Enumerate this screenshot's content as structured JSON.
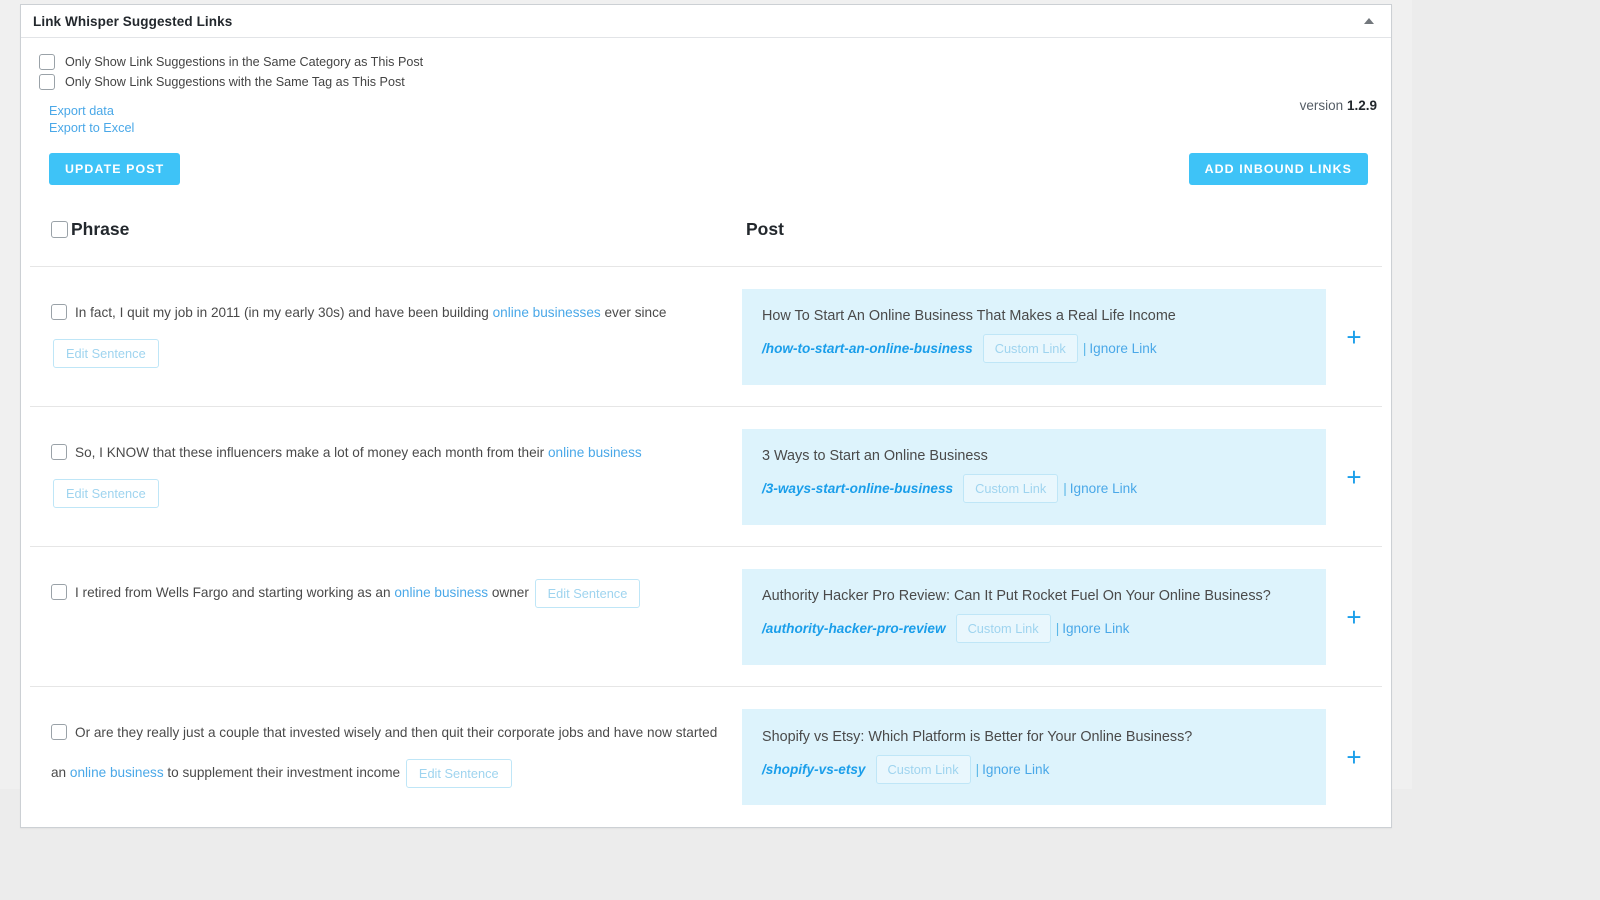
{
  "panel": {
    "title": "Link Whisper Suggested Links",
    "toggle_icon": "chevron-up-icon",
    "version_label": "version",
    "version_number": "1.2.9"
  },
  "filters": [
    {
      "label": "Only Show Link Suggestions in the Same Category as This Post",
      "checked": false
    },
    {
      "label": "Only Show Link Suggestions with the Same Tag as This Post",
      "checked": false
    }
  ],
  "export": {
    "data_label": "Export data",
    "excel_label": "Export to Excel"
  },
  "buttons": {
    "update_post": "UPDATE POST",
    "add_inbound_links": "ADD INBOUND LINKS"
  },
  "table": {
    "headers": {
      "phrase": "Phrase",
      "post": "Post"
    },
    "row_actions": {
      "edit_sentence": "Edit Sentence",
      "custom_link": "Custom Link",
      "ignore_link": "Ignore Link",
      "separator": "|",
      "add_icon": "plus-icon"
    },
    "rows": [
      {
        "phrase_pre": "In fact, I quit my job in 2011 (in my early 30s) and have been building ",
        "phrase_kw": "online businesses",
        "phrase_post": " ever since ",
        "post_title": "How To Start An Online Business That Makes a Real Life Income",
        "post_slug": "/how-to-start-an-online-business"
      },
      {
        "phrase_pre": "So, I KNOW that these influencers make a lot of money each month from their ",
        "phrase_kw": "online business",
        "phrase_post": " ",
        "post_title": "3 Ways to Start an Online Business",
        "post_slug": "/3-ways-start-online-business"
      },
      {
        "phrase_pre": "I retired from Wells Fargo and starting working as an ",
        "phrase_kw": "online business",
        "phrase_post": " owner ",
        "post_title": "Authority Hacker Pro Review: Can It Put Rocket Fuel On Your Online Business?",
        "post_slug": "/authority-hacker-pro-review"
      },
      {
        "phrase_pre": "Or are they really just a couple that invested wisely and then quit their corporate jobs and have now started an ",
        "phrase_kw": "online business",
        "phrase_post": " to supplement their investment income ",
        "post_title": "Shopify vs Etsy: Which Platform is Better for Your Online Business?",
        "post_slug": "/shopify-vs-etsy"
      }
    ]
  },
  "colors": {
    "accent": "#3ec3f7",
    "link": "#4aa8e8",
    "card_bg": "#ddf3fc",
    "slug": "#1a9eea"
  }
}
